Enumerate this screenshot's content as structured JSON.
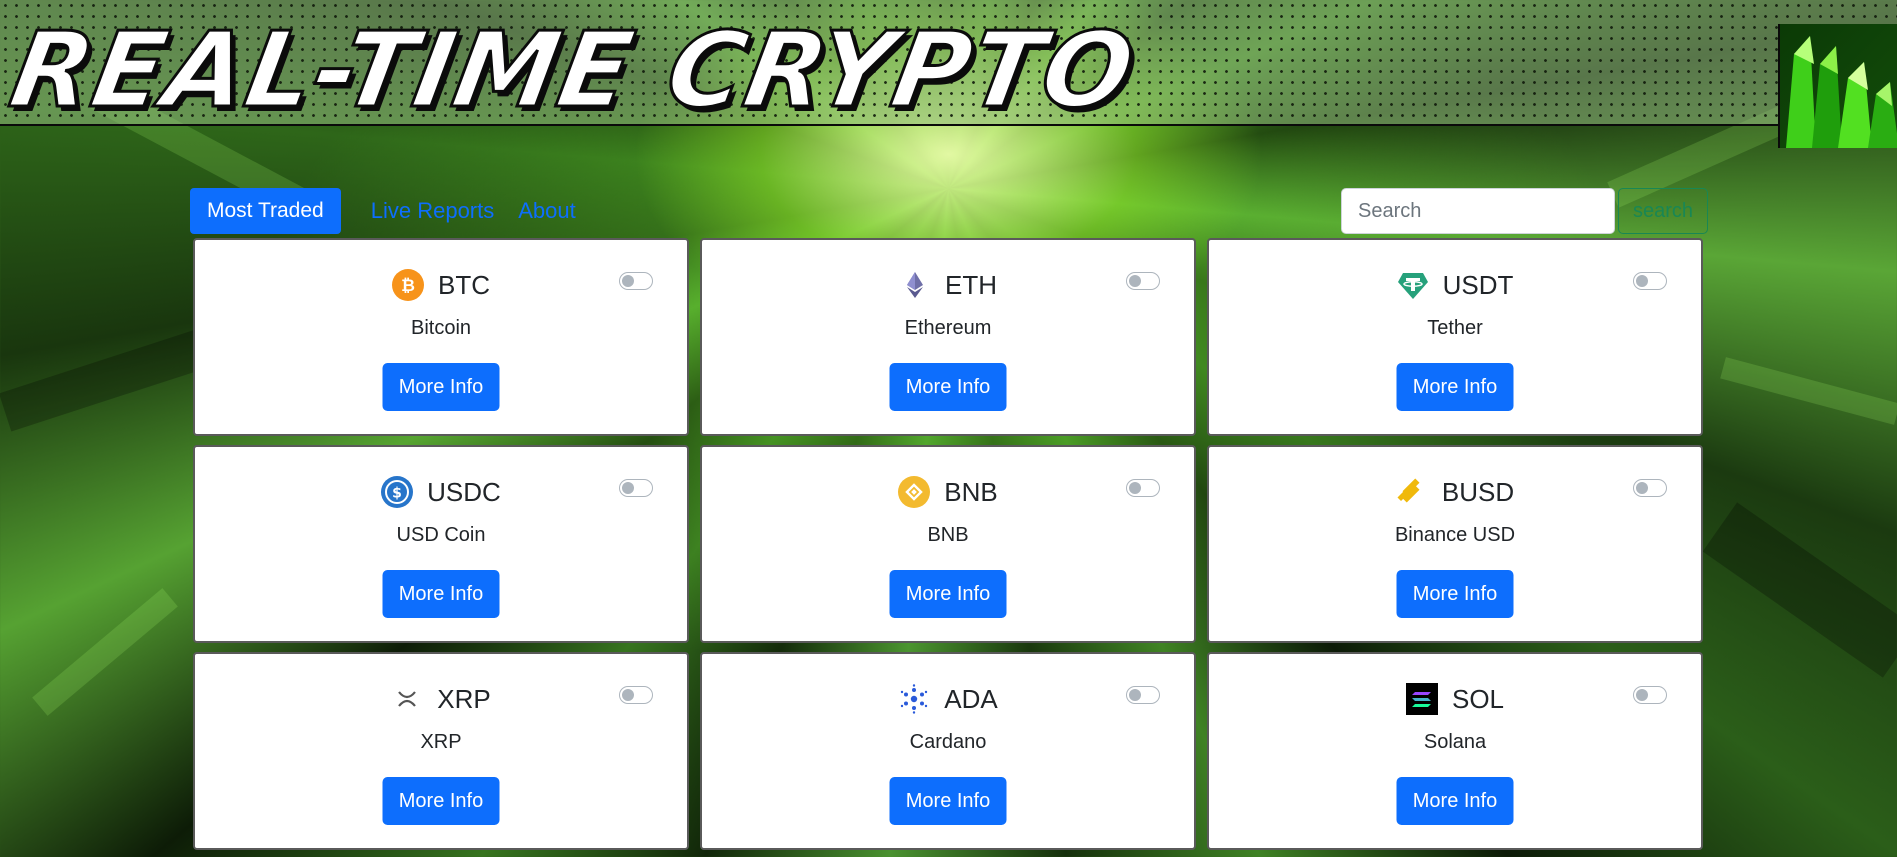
{
  "header": {
    "title": "REAL-TIME CRYPTO"
  },
  "nav": {
    "items": [
      "Most Traded",
      "Live Reports",
      "About"
    ]
  },
  "search": {
    "placeholder": "Search",
    "button_label": "search"
  },
  "coins": [
    {
      "symbol": "BTC",
      "name": "Bitcoin",
      "icon": "bitcoin-icon",
      "button_label": "More Info"
    },
    {
      "symbol": "ETH",
      "name": "Ethereum",
      "icon": "ethereum-icon",
      "button_label": "More Info"
    },
    {
      "symbol": "USDT",
      "name": "Tether",
      "icon": "tether-icon",
      "button_label": "More Info"
    },
    {
      "symbol": "USDC",
      "name": "USD Coin",
      "icon": "usd-coin-icon",
      "button_label": "More Info"
    },
    {
      "symbol": "BNB",
      "name": "BNB",
      "icon": "bnb-icon",
      "button_label": "More Info"
    },
    {
      "symbol": "BUSD",
      "name": "Binance USD",
      "icon": "binance-usd-icon",
      "button_label": "More Info"
    },
    {
      "symbol": "XRP",
      "name": "XRP",
      "icon": "xrp-icon",
      "button_label": "More Info"
    },
    {
      "symbol": "ADA",
      "name": "Cardano",
      "icon": "cardano-icon",
      "button_label": "More Info"
    },
    {
      "symbol": "SOL",
      "name": "Solana",
      "icon": "solana-icon",
      "button_label": "More Info"
    }
  ],
  "colors": {
    "primary": "#0d6efd",
    "success": "#198754",
    "accent_green": "#7ed321"
  }
}
